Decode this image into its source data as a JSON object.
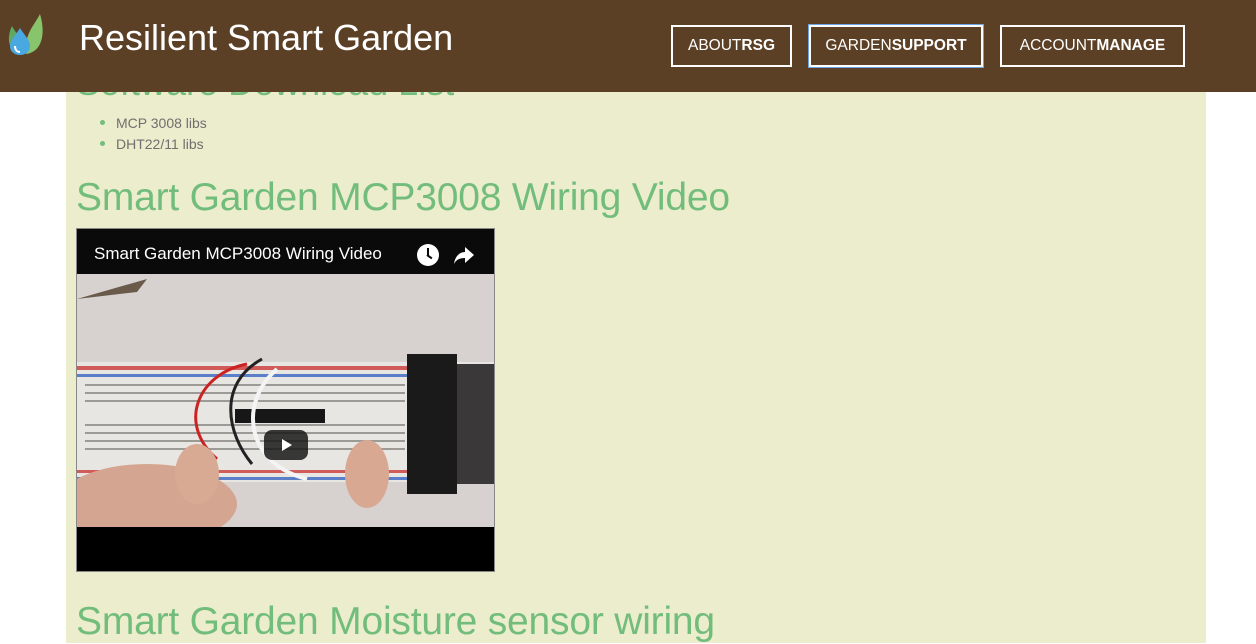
{
  "nav": {
    "brand": "Resilient Smart Garden",
    "buttons": [
      {
        "light": "ABOUT",
        "bold": "RSG"
      },
      {
        "light": "GARDEN",
        "bold": "SUPPORT"
      },
      {
        "light": "ACCOUNT",
        "bold": "MANAGE"
      }
    ]
  },
  "downloads": {
    "heading": "Software Download List",
    "items": [
      "MCP 3008 libs",
      "DHT22/11 libs"
    ]
  },
  "video_section": {
    "heading": "Smart Garden MCP3008 Wiring Video",
    "video_title": "Smart Garden MCP3008 Wiring Video"
  },
  "moisture_section": {
    "heading": "Smart Garden Moisture sensor wiring"
  },
  "icons": [
    "water-drop-leaf-logo",
    "clock-icon",
    "share-icon",
    "play-icon"
  ],
  "colors": {
    "navbar": "#5c4026",
    "content_bg": "#ecedcc",
    "heading_green": "#72bd7c",
    "active_outline": "#6ca4e6"
  }
}
